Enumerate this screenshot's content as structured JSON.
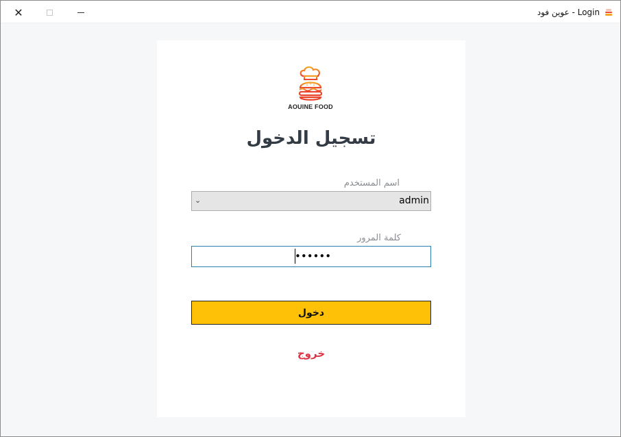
{
  "window": {
    "title": "عوين فود - Login",
    "close_glyph": "✕"
  },
  "logo": {
    "brand_text": "AOUINE FOOD",
    "icon": "burger-chef-logo",
    "colors": {
      "gradient_start": "#f5a623",
      "gradient_end": "#e8452c"
    }
  },
  "form": {
    "heading": "تسجيل الدخول",
    "username_label": "اسم المستخدم",
    "username_value": "admin",
    "password_label": "كلمة المرور",
    "password_mask": "••••••",
    "login_button": "دخول",
    "exit_link": "خروج"
  },
  "colors": {
    "login_button_bg": "#ffc107",
    "exit_link": "#dc3545",
    "focus_border": "#2a7fb0",
    "page_bg": "#f6f7f9"
  }
}
